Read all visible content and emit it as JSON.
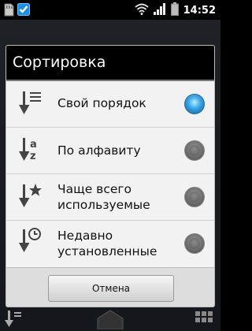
{
  "status_bar": {
    "time": "14:52",
    "icons": [
      "sd-card-icon",
      "checkbox-icon",
      "wifi-icon",
      "signal-icon",
      "battery-icon"
    ]
  },
  "dialog": {
    "title": "Сортировка",
    "options": [
      {
        "label": "Свой порядок",
        "icon": "custom-order-icon",
        "checked": true
      },
      {
        "label": "По алфавиту",
        "icon": "alphabet-sort-icon",
        "checked": false
      },
      {
        "label": "Чаще всего используемые",
        "icon": "most-used-icon",
        "checked": false
      },
      {
        "label": "Недавно установленные",
        "icon": "recently-installed-icon",
        "checked": false
      }
    ],
    "cancel_label": "Отмена"
  },
  "colors": {
    "radio_checked": "#2a8fd0",
    "radio_unchecked": "#6a6a6a",
    "dialog_title_bg": "#000000",
    "list_bg": "#f2f2f2"
  }
}
